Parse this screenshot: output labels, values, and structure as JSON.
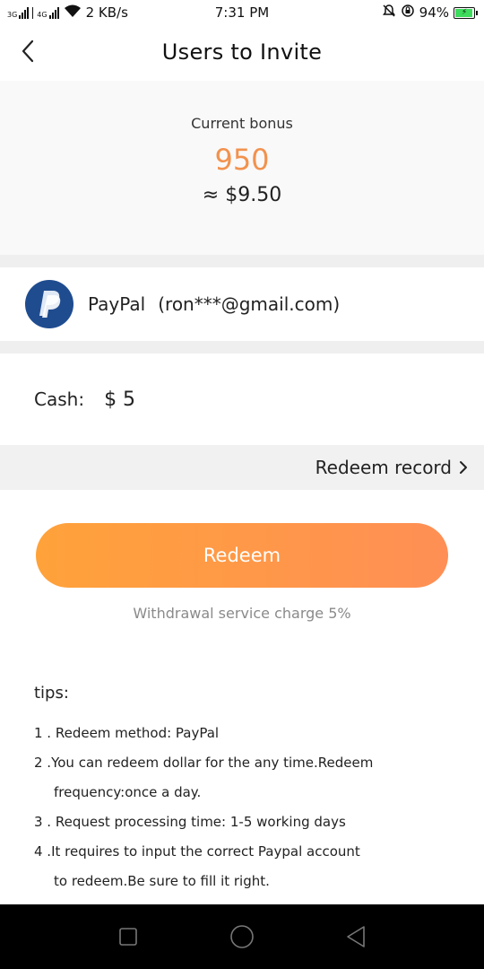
{
  "status_bar": {
    "network_1": "3G",
    "network_2": "4G",
    "speed": "2 KB/s",
    "time": "7:31 PM",
    "battery": "94%",
    "icons": [
      "signal-icon",
      "wifi-icon",
      "bell-off-icon",
      "rotation-lock-icon",
      "battery-charging-icon"
    ]
  },
  "header": {
    "title": "Users to Invite",
    "back_icon": "chevron-left-icon"
  },
  "bonus": {
    "label": "Current bonus",
    "value": "950",
    "usd": "≈ $9.50",
    "accent_color": "#f2924e"
  },
  "payment": {
    "icon": "paypal-icon",
    "method": "PayPal",
    "account": "(ron***@gmail.com)"
  },
  "cash": {
    "label": "Cash:",
    "value": "$ 5"
  },
  "record": {
    "label": "Redeem record",
    "icon": "chevron-right-icon"
  },
  "redeem": {
    "button_label": "Redeem",
    "note": "Withdrawal service charge 5%",
    "gradient": [
      "#ffa23a",
      "#ff8f55"
    ]
  },
  "tips": {
    "title": "tips:",
    "items": [
      {
        "line1": "1 . Redeem method: PayPal",
        "line2": ""
      },
      {
        "line1": "2 .You can redeem dollar for the any time.Redeem",
        "line2": "frequency:once a day."
      },
      {
        "line1": "3 . Request processing time: 1-5 working days",
        "line2": ""
      },
      {
        "line1": "4 .It requires to input the correct Paypal account",
        "line2": "to redeem.Be sure to fill it right."
      }
    ]
  },
  "system_nav": {
    "icons": [
      "recent-apps-icon",
      "home-icon",
      "back-icon"
    ]
  }
}
